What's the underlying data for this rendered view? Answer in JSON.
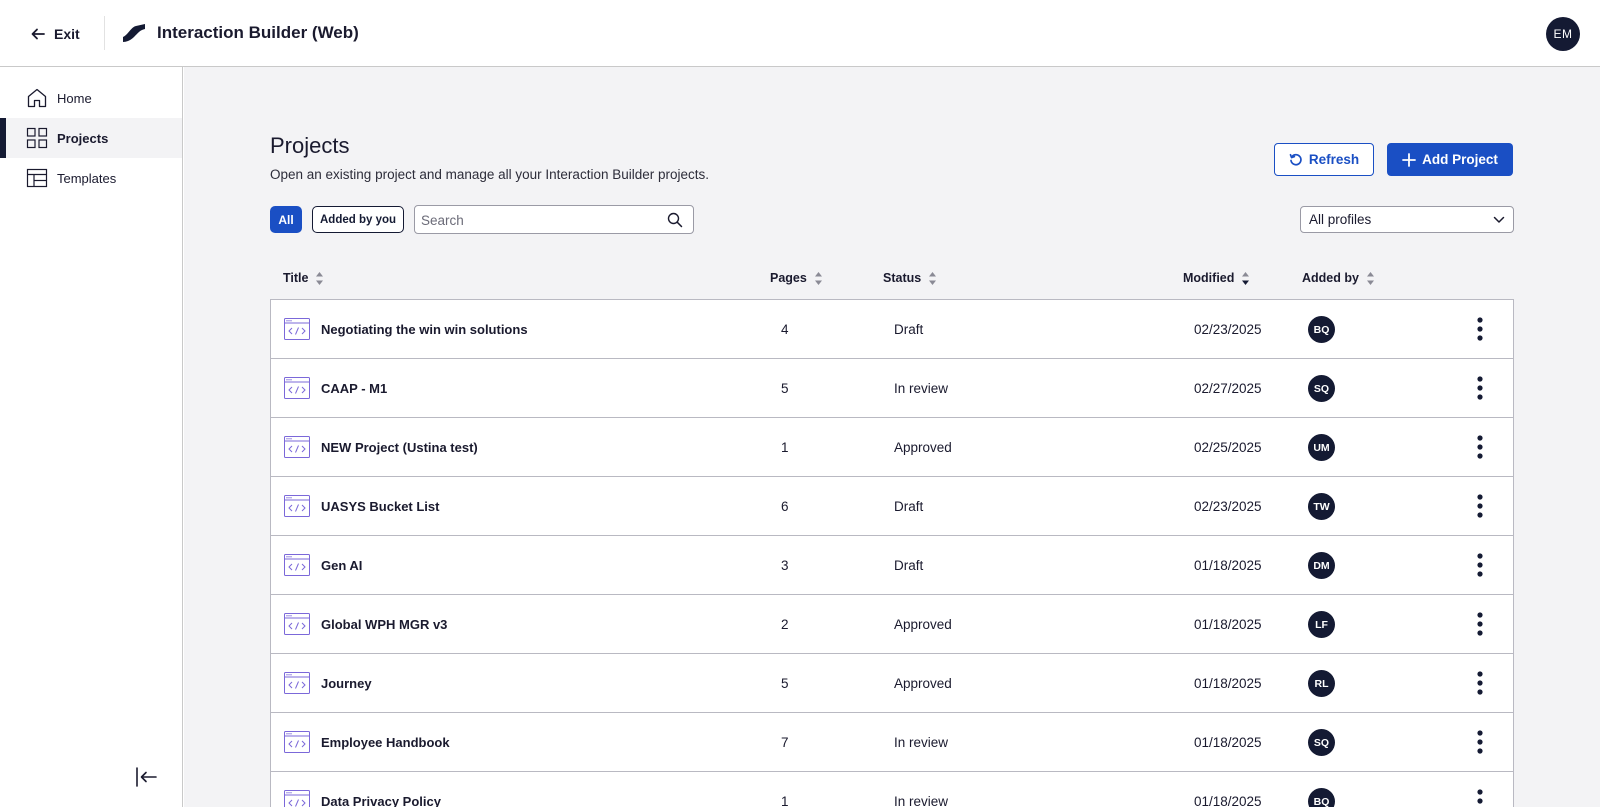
{
  "header": {
    "exit_label": "Exit",
    "app_title": "Interaction Builder (Web)",
    "user_initials": "EM"
  },
  "sidebar": {
    "items": [
      {
        "label": "Home",
        "icon": "home-icon",
        "active": false
      },
      {
        "label": "Projects",
        "icon": "grid-icon",
        "active": true
      },
      {
        "label": "Templates",
        "icon": "template-icon",
        "active": false
      }
    ]
  },
  "page": {
    "title": "Projects",
    "subtitle": "Open an existing project and manage all your Interaction Builder projects.",
    "refresh_label": "Refresh",
    "add_label": "Add Project"
  },
  "filters": {
    "all_label": "All",
    "mine_label": "Added by you",
    "search_placeholder": "Search",
    "profile_selected": "All profiles"
  },
  "table": {
    "columns": {
      "title": "Title",
      "pages": "Pages",
      "status": "Status",
      "modified": "Modified",
      "added_by": "Added by"
    },
    "rows": [
      {
        "title": "Negotiating the win win solutions",
        "pages": "4",
        "status": "Draft",
        "modified": "02/23/2025",
        "added_by": "BQ"
      },
      {
        "title": "CAAP - M1",
        "pages": "5",
        "status": "In review",
        "modified": "02/27/2025",
        "added_by": "SQ"
      },
      {
        "title": "NEW Project (Ustina test)",
        "pages": "1",
        "status": "Approved",
        "modified": "02/25/2025",
        "added_by": "UM"
      },
      {
        "title": "UASYS Bucket List",
        "pages": "6",
        "status": "Draft",
        "modified": "02/23/2025",
        "added_by": "TW"
      },
      {
        "title": "Gen AI",
        "pages": "3",
        "status": "Draft",
        "modified": "01/18/2025",
        "added_by": "DM"
      },
      {
        "title": "Global WPH MGR v3",
        "pages": "2",
        "status": "Approved",
        "modified": "01/18/2025",
        "added_by": "LF"
      },
      {
        "title": "Journey",
        "pages": "5",
        "status": "Approved",
        "modified": "01/18/2025",
        "added_by": "RL"
      },
      {
        "title": "Employee Handbook",
        "pages": "7",
        "status": "In review",
        "modified": "01/18/2025",
        "added_by": "SQ"
      },
      {
        "title": "Data Privacy Policy",
        "pages": "1",
        "status": "In review",
        "modified": "01/18/2025",
        "added_by": "BQ"
      }
    ]
  },
  "colors": {
    "primary": "#1a4fc4",
    "navy": "#141a33",
    "icon_accent": "#7b68d9",
    "main_bg": "#f3f3f5",
    "border": "#b9b9c2"
  }
}
